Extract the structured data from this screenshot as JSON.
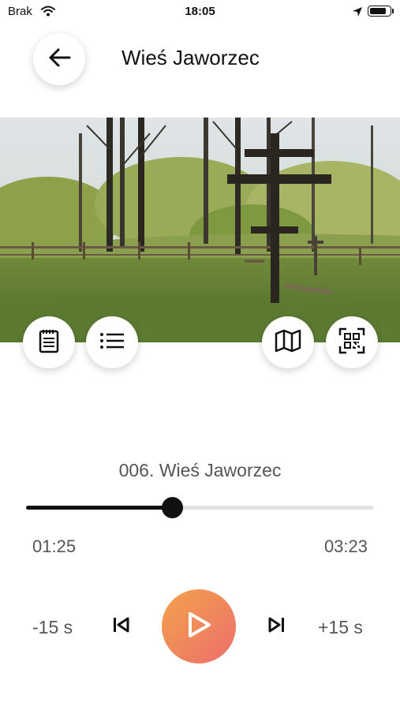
{
  "status_bar": {
    "carrier": "Brak",
    "time": "18:05",
    "battery_level": 0.9
  },
  "header": {
    "back_icon": "arrow-left-icon",
    "title": "Wieś Jaworzec"
  },
  "photo_toolbar": {
    "left": [
      {
        "icon": "notes-icon"
      },
      {
        "icon": "list-icon"
      }
    ],
    "right": [
      {
        "icon": "map-icon"
      },
      {
        "icon": "qr-scan-icon"
      }
    ]
  },
  "player": {
    "track_title": "006. Wieś Jaworzec",
    "elapsed": "01:25",
    "total": "03:23",
    "progress": 0.42,
    "skip_back_label": "-15 s",
    "skip_forward_label": "+15 s",
    "play_gradient": [
      "#f3a24c",
      "#ec6f6c"
    ]
  }
}
